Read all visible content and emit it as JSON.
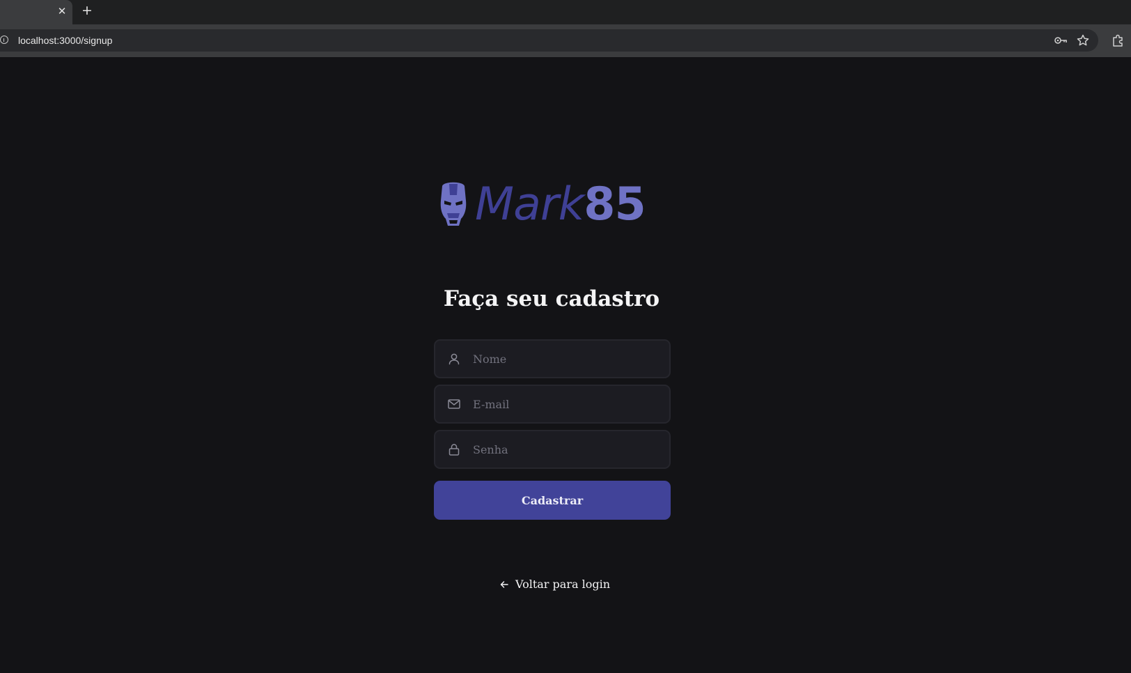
{
  "browser": {
    "tab_close_glyph": "✕",
    "new_tab_glyph": "+",
    "url": "localhost:3000/signup",
    "icons": [
      "site-info-icon",
      "password-key-icon",
      "bookmark-star-icon",
      "extensions-icon"
    ]
  },
  "logo": {
    "word": "Mark",
    "number": "85",
    "icon": "iron-man-helmet-icon",
    "colors": {
      "word": "#3f4095",
      "number": "#6f72c4",
      "helmet": "#6f72c4"
    }
  },
  "signup": {
    "title": "Faça seu cadastro",
    "fields": {
      "name_placeholder": "Nome",
      "email_placeholder": "E-mail",
      "password_placeholder": "Senha"
    },
    "submit_label": "Cadastrar",
    "back_label": "Voltar para login"
  },
  "colors": {
    "background": "#131316",
    "input_background": "#1c1c22",
    "button": "#414399",
    "text": "#f4f4f5",
    "placeholder": "#72727e"
  }
}
